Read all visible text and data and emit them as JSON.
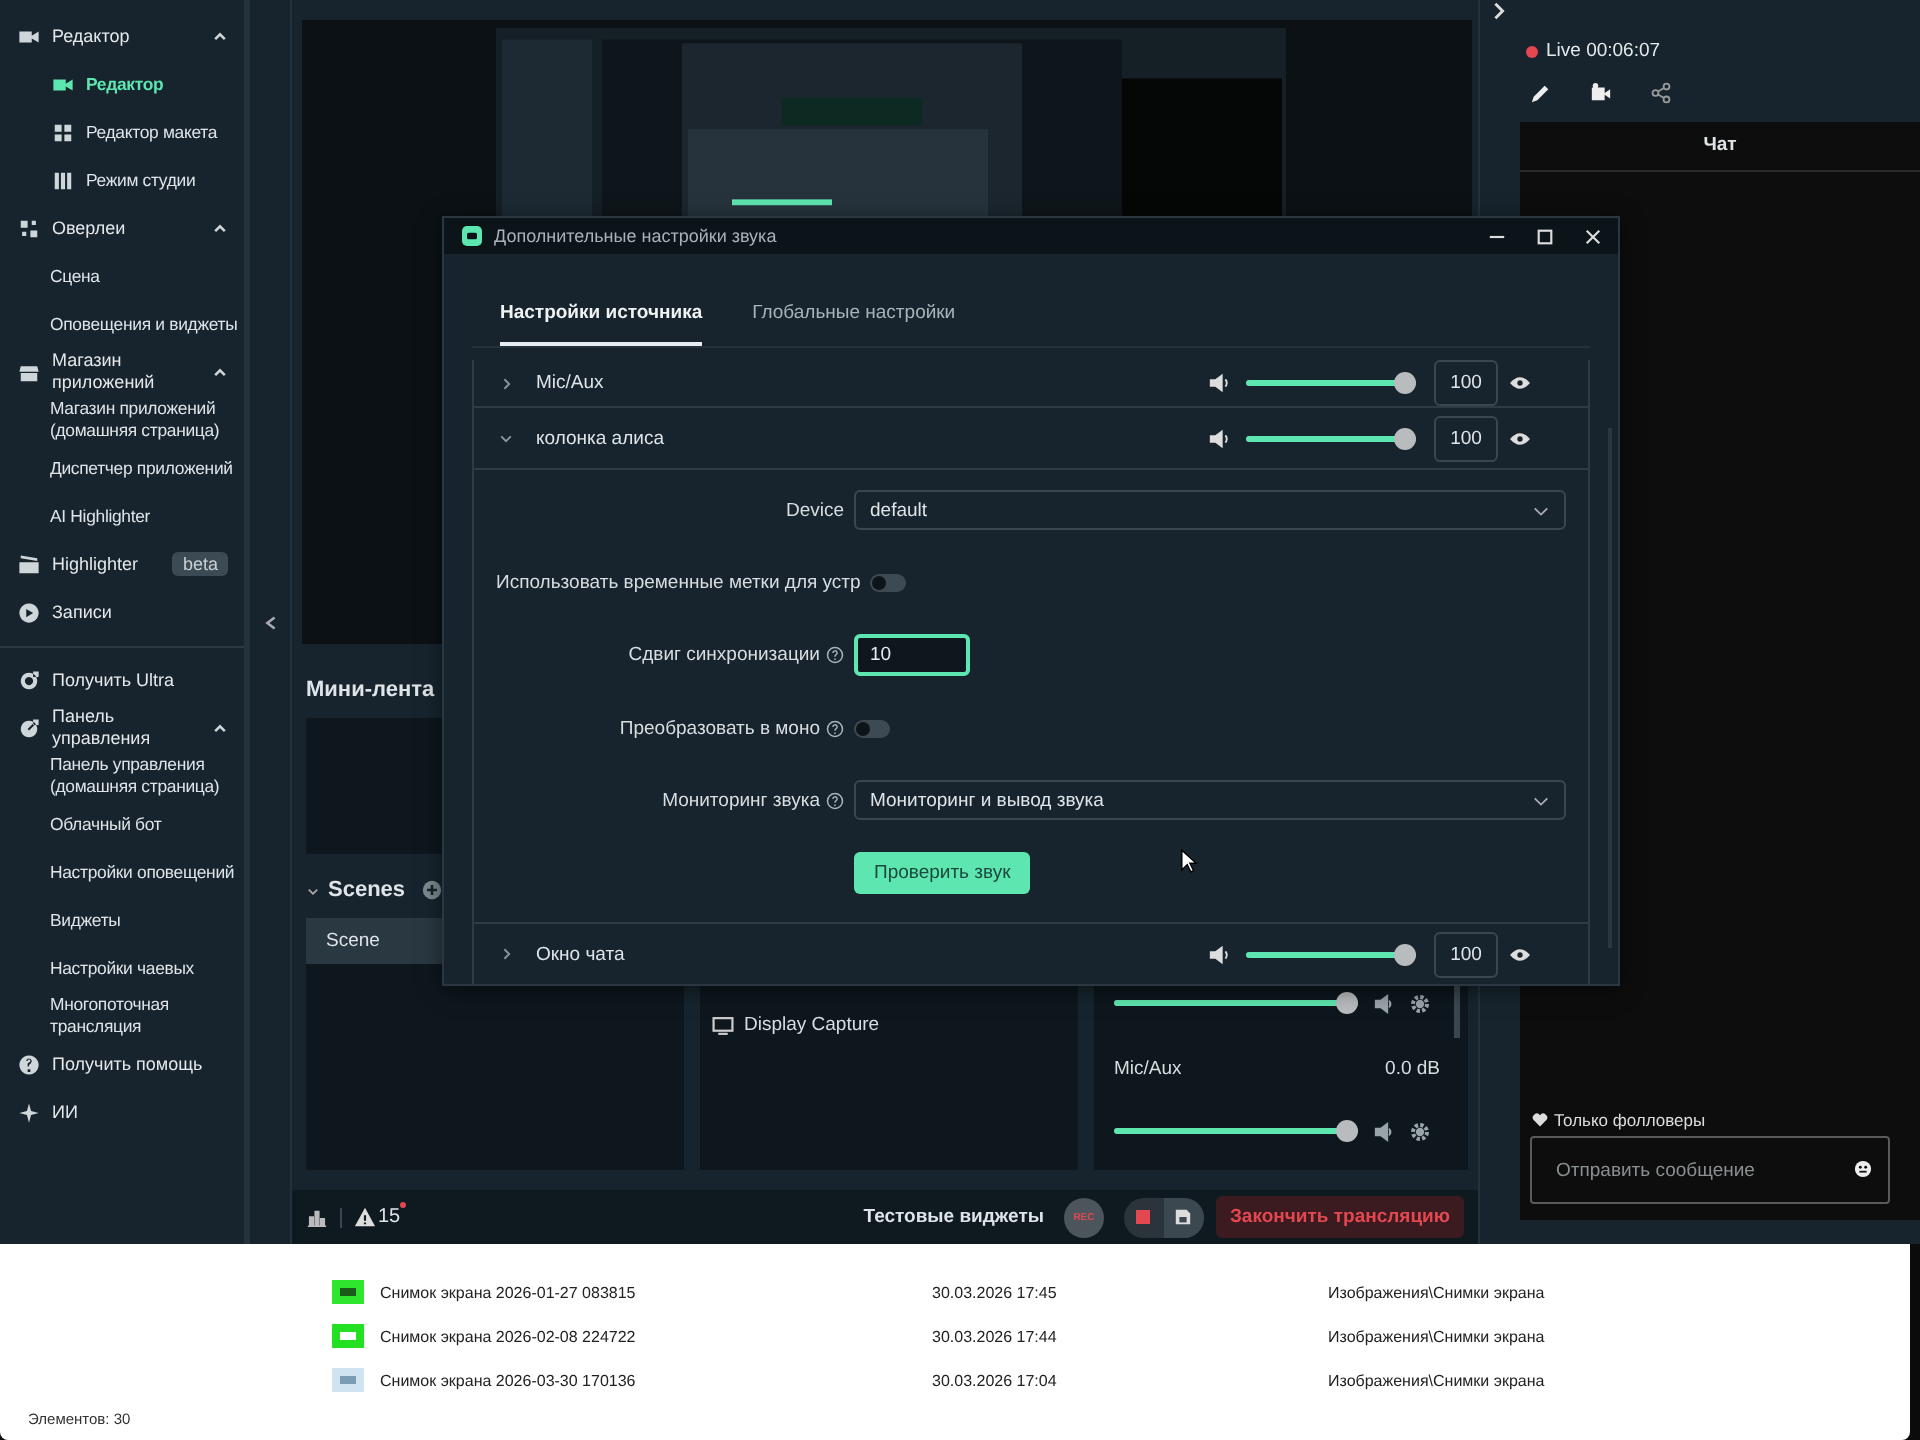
{
  "sidebar": {
    "sections": [
      {
        "items": [
          {
            "label": "Редактор",
            "selected": false,
            "expanded": true,
            "children": [
              {
                "label": "Редактор",
                "selected": true
              },
              {
                "label": "Редактор макета",
                "selected": false
              },
              {
                "label": "Режим студии",
                "selected": false
              }
            ]
          },
          {
            "label": "Оверлеи",
            "selected": false,
            "expanded": true,
            "children": [
              {
                "label": "Сцена",
                "selected": false
              },
              {
                "label": "Оповещения и виджеты",
                "selected": false
              }
            ]
          },
          {
            "label": "Магазин приложений",
            "selected": false,
            "expanded": true,
            "children": [
              {
                "label": "Магазин приложений (домашняя страница)",
                "selected": false
              },
              {
                "label": "Диспетчер приложений",
                "selected": false
              },
              {
                "label": "AI Highlighter",
                "selected": false
              }
            ]
          },
          {
            "label": "Highlighter",
            "selected": false,
            "badge": "beta"
          },
          {
            "label": "Записи",
            "selected": false
          }
        ]
      },
      {
        "items": [
          {
            "label": "Получить Ultra",
            "selected": false
          },
          {
            "label": "Панель управления",
            "selected": false,
            "expanded": true,
            "children": [
              {
                "label": "Панель управления (домашняя страница)",
                "selected": false
              },
              {
                "label": "Облачный бот",
                "selected": false
              },
              {
                "label": "Настройки оповещений",
                "selected": false
              },
              {
                "label": "Виджеты",
                "selected": false
              },
              {
                "label": "Настройки чаевых",
                "selected": false
              },
              {
                "label": "Многопоточная трансляция",
                "selected": false
              }
            ]
          },
          {
            "label": "Получить помощь",
            "selected": false
          },
          {
            "label": "ИИ",
            "selected": false
          }
        ]
      }
    ]
  },
  "mini_feed": {
    "title": "Мини-лента"
  },
  "scenes": {
    "title": "Scenes",
    "items": [
      {
        "label": "Scene",
        "selected": true
      }
    ]
  },
  "sources": {
    "items": [
      {
        "label": "Display Capture"
      }
    ]
  },
  "mixer": {
    "channels": [
      {
        "level": 1
      },
      {
        "name": "Mic/Aux",
        "reading": "0.0 dB",
        "level": 1
      }
    ]
  },
  "bottom_bar": {
    "warnings": "15",
    "test_widgets": "Тестовые виджеты",
    "rec": "REC",
    "end_stream": "Закончить трансляцию"
  },
  "right_panel": {
    "live": "Live 00:06:07",
    "chat": {
      "title": "Чат",
      "followers_only": "Только фолловеры",
      "placeholder": "Отправить сообщение"
    }
  },
  "dialog": {
    "title": "Дополнительные настройки звука",
    "tabs": [
      {
        "label": "Настройки источника",
        "selected": true
      },
      {
        "label": "Глобальные настройки",
        "selected": false
      }
    ],
    "sources": [
      {
        "name": "Mic/Aux",
        "expanded": false,
        "level": 1,
        "volume": "100"
      },
      {
        "name": "колонка алиса",
        "expanded": true,
        "level": 1,
        "volume": "100",
        "fields": [
          {
            "kind": "select",
            "label": "Device",
            "help": false,
            "value": "default"
          },
          {
            "kind": "toggle",
            "label": "Использовать временные метки для устр",
            "help": false,
            "on": false
          },
          {
            "kind": "input",
            "label": "Сдвиг синхронизации",
            "help": true,
            "value": "10",
            "focused": true
          },
          {
            "kind": "toggle",
            "label": "Преобразовать в моно",
            "help": true,
            "on": false
          },
          {
            "kind": "select",
            "label": "Мониторинг звука",
            "help": true,
            "value": "Мониторинг и вывод звука"
          }
        ],
        "test_button": "Проверить звук"
      },
      {
        "name": "Окно чата",
        "expanded": false,
        "level": 1,
        "volume": "100"
      }
    ]
  },
  "explorer": {
    "rows": [
      {
        "name": "Снимок экрана 2026-01-27 083815",
        "date": "30.03.2026 17:45",
        "path": "Изображения\\Снимки экрана"
      },
      {
        "name": "Снимок экрана 2026-02-08 224722",
        "date": "30.03.2026 17:44",
        "path": "Изображения\\Снимки экрана"
      },
      {
        "name": "Снимок экрана 2026-03-30 170136",
        "date": "30.03.2026 17:04",
        "path": "Изображения\\Снимки экрана"
      }
    ],
    "status": "Элементов: 30"
  }
}
